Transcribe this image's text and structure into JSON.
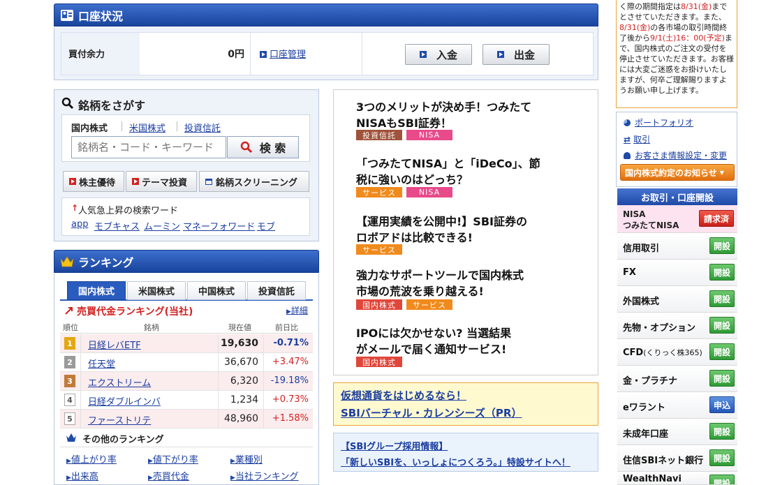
{
  "account": {
    "title": "口座状況",
    "buying_power_label": "買付余力",
    "buying_power_value": "0円",
    "manage_link": "口座管理",
    "deposit_button": "入金",
    "withdraw_button": "出金"
  },
  "search": {
    "title": "銘柄をさがす",
    "tabs": [
      "国内株式",
      "米国株式",
      "投資信託"
    ],
    "placeholder": "銘柄名・コード・キーワード",
    "search_button": "検 索",
    "buttons": [
      "株主優待",
      "テーマ投資",
      "銘柄スクリーニング"
    ],
    "trending_title": "人気急上昇の検索ワード",
    "trending_words": [
      "app",
      "モブキャス",
      "ムーミン",
      "マネーフォワード",
      "モブ"
    ]
  },
  "ranking": {
    "title": "ランキング",
    "tabs": [
      "国内株式",
      "米国株式",
      "中国株式",
      "投資信託"
    ],
    "subtitle": "売買代金ランキング(当社)",
    "detail_link": "詳細",
    "columns": [
      "順位",
      "銘柄",
      "現在値",
      "前日比"
    ],
    "rows": [
      {
        "rank": "1",
        "name": "日経レバETF",
        "price": "19,630",
        "change": "-0.71%"
      },
      {
        "rank": "2",
        "name": "任天堂",
        "price": "36,670",
        "change": "+3.47%"
      },
      {
        "rank": "3",
        "name": "エクストリーム",
        "price": "6,320",
        "change": "-19.18%"
      },
      {
        "rank": "4",
        "name": "日経ダブルインバ",
        "price": "1,234",
        "change": "+0.73%"
      },
      {
        "rank": "5",
        "name": "ファーストリテ",
        "price": "48,960",
        "change": "+1.58%"
      }
    ],
    "other_title": "その他のランキング",
    "other_links": [
      "値上がり率",
      "値下がり率",
      "業種別",
      "出来高",
      "売買代金",
      "当社ランキング"
    ]
  },
  "news": [
    {
      "line1": "3つのメリットが決め手！つみたて",
      "line2": "NISAもSBI証券！",
      "tags": [
        "投資信託",
        "NISA"
      ]
    },
    {
      "line1": "「つみたてNISA」と「iDeCo」、節",
      "line2": "税に強いのはどっち？",
      "tags": [
        "サービス",
        "NISA"
      ]
    },
    {
      "line1": "【運用実績を公開中!】SBI証券の",
      "line2": "ロボアドは比較できる!",
      "tags": [
        "サービス"
      ]
    },
    {
      "line1": "強力なサポートツールで国内株式",
      "line2": "市場の荒波を乗り越える!",
      "tags": [
        "国内株式",
        "サービス"
      ]
    },
    {
      "line1": "IPOには欠かせない? 当選結果",
      "line2": "がメールで届く通知サービス!",
      "tags": [
        "国内株式"
      ]
    }
  ],
  "promo": {
    "line1": "仮想通貨をはじめるなら！",
    "line2": "SBIバーチャル・カレンシーズ（PR）"
  },
  "recruit": {
    "line1": "【SBIグループ採用情報】",
    "line2": "「新しいSBIを、いっしょにつくろう。」特設サイトへ！"
  },
  "notice": {
    "t1": "く際の期間指定は",
    "r1": "8/31(金)",
    "t2": "までとさせていただきます。また、",
    "r2": "8/31(金)",
    "t3": "の各市場の取引時間終了後から",
    "r3": "9/1(土)16：00(予定)",
    "t4": "まで、国内株式のご注文の受付を停止させていただきます。お客様には大変ご迷惑をお掛けいたしますが、何卒ご理解賜りますようお願い申し上げます。"
  },
  "side": {
    "links": [
      "ポートフォリオ",
      "取引",
      "お客さま情報設定・変更"
    ],
    "notice_button": "国内株式約定のお知らせ",
    "open_title": "お取引・口座開設",
    "nisa_line1": "NISA",
    "nisa_line2": "つみたてNISA",
    "nisa_button": "請求済",
    "items": [
      {
        "label": "信用取引",
        "button": "開設"
      },
      {
        "label": "FX",
        "button": "開設"
      },
      {
        "label": "外国株式",
        "button": "開設"
      },
      {
        "label": "先物・オプション",
        "button": "開設"
      },
      {
        "label": "CFD",
        "label_small": "(くりっく株365)",
        "button": "開設"
      },
      {
        "label": "金・プラチナ",
        "button": "開設"
      },
      {
        "label": "eワラント",
        "button": "申込"
      },
      {
        "label": "未成年口座",
        "button": "開設"
      },
      {
        "label": "住信SBIネット銀行",
        "button": "開設"
      },
      {
        "label": "WealthNavi",
        "button": "開設"
      }
    ]
  },
  "colors": {
    "header_blue": "#1f4aa8",
    "rank_gold": "#e3a812",
    "rank_silver": "#9a9a9a",
    "rank_bronze": "#c07a3a",
    "negative": "#1a3da0",
    "positive": "#d32121",
    "tag_brown": "#a0523a",
    "tag_pink": "#e84a8a",
    "tag_orange": "#f18a1c",
    "tag_red": "#e0463a",
    "open_green": "#2f9a35"
  }
}
